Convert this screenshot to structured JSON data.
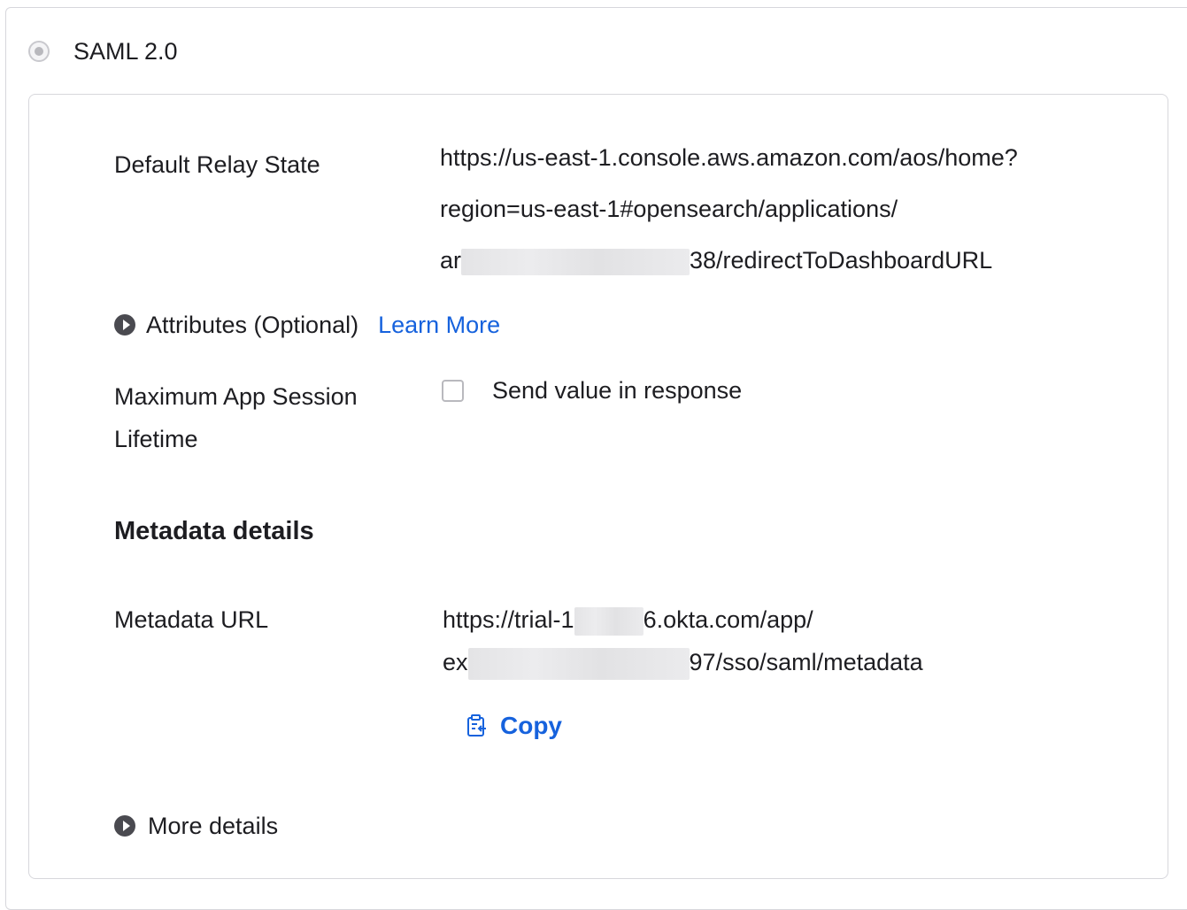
{
  "saml": {
    "radio_label": "SAML 2.0"
  },
  "relay_state": {
    "label": "Default Relay State",
    "line1": "https://us-east-1.console.aws.amazon.com/aos/home?",
    "line2": "region=us-east-1#opensearch/applications/",
    "line3_prefix": "ar",
    "line3_suffix": "38/redirectToDashboardURL"
  },
  "attributes": {
    "label": "Attributes (Optional)",
    "learn_more": "Learn More"
  },
  "session": {
    "label_line1": "Maximum App Session",
    "label_line2": "Lifetime",
    "checkbox_label": "Send value in response",
    "checked": false
  },
  "metadata": {
    "title": "Metadata details",
    "url_label": "Metadata URL",
    "url_line1_prefix": "https://trial-1",
    "url_line1_suffix": "6.okta.com/app/",
    "url_line2_prefix": "ex",
    "url_line2_suffix": "97/sso/saml/metadata",
    "copy_label": "Copy"
  },
  "more_details": {
    "label": "More details"
  },
  "colors": {
    "link": "#1662dd",
    "text": "#1d1d21",
    "border": "#d7d7dc"
  }
}
